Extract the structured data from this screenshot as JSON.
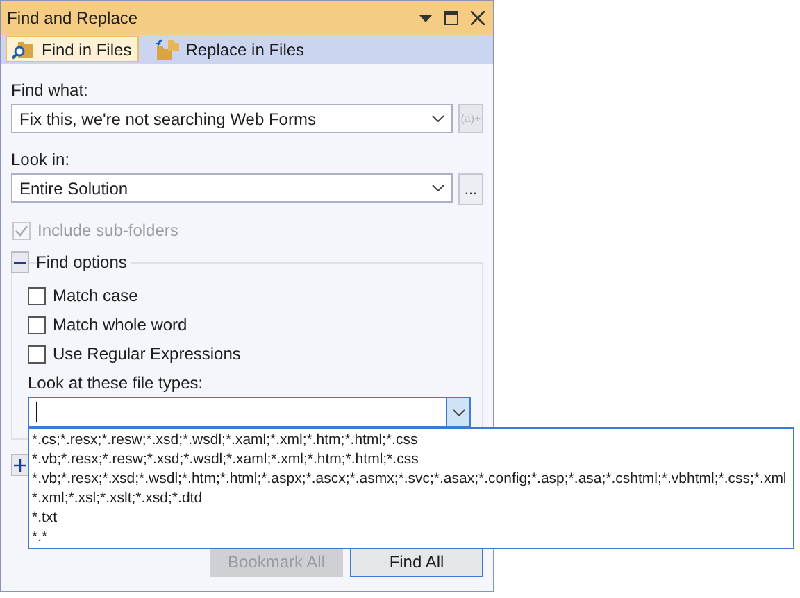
{
  "window": {
    "title": "Find and Replace"
  },
  "tabs": [
    {
      "label": "Find in Files",
      "selected": true
    },
    {
      "label": "Replace in Files",
      "selected": false
    }
  ],
  "find_what": {
    "label": "Find what:",
    "value": "Fix this, we're not searching Web Forms",
    "regex_button": {
      "label": "(a)+",
      "disabled": true
    }
  },
  "look_in": {
    "label": "Look in:",
    "value": "Entire Solution",
    "browse_button": {
      "label": "..."
    }
  },
  "include_subfolders": {
    "label": "Include sub-folders",
    "checked": true,
    "disabled": true
  },
  "find_options": {
    "label": "Find options",
    "expanded": true,
    "checkboxes": [
      {
        "label": "Match case",
        "checked": false
      },
      {
        "label": "Match whole word",
        "checked": false
      },
      {
        "label": "Use Regular Expressions",
        "checked": false
      }
    ],
    "file_types": {
      "label": "Look at these file types:",
      "dropdown_open": true,
      "options": [
        "*.cs;*.resx;*.resw;*.xsd;*.wsdl;*.xaml;*.xml;*.htm;*.html;*.css",
        "*.vb;*.resx;*.resw;*.xsd;*.wsdl;*.xaml;*.xml;*.htm;*.html;*.css",
        "*.vb;*.resx;*.xsd;*.wsdl;*.htm;*.html;*.aspx;*.ascx;*.asmx;*.svc;*.asax;*.config;*.asp;*.asa;*.cshtml;*.vbhtml;*.css;*.xml",
        "*.xml;*.xsl;*.xslt;*.xsd;*.dtd",
        "*.txt",
        "*.*"
      ]
    }
  },
  "result_options": {
    "expanded": false
  },
  "buttons": [
    {
      "label": "Bookmark All",
      "disabled": true,
      "default": false
    },
    {
      "label": "Find All",
      "disabled": false,
      "default": true
    }
  ]
}
